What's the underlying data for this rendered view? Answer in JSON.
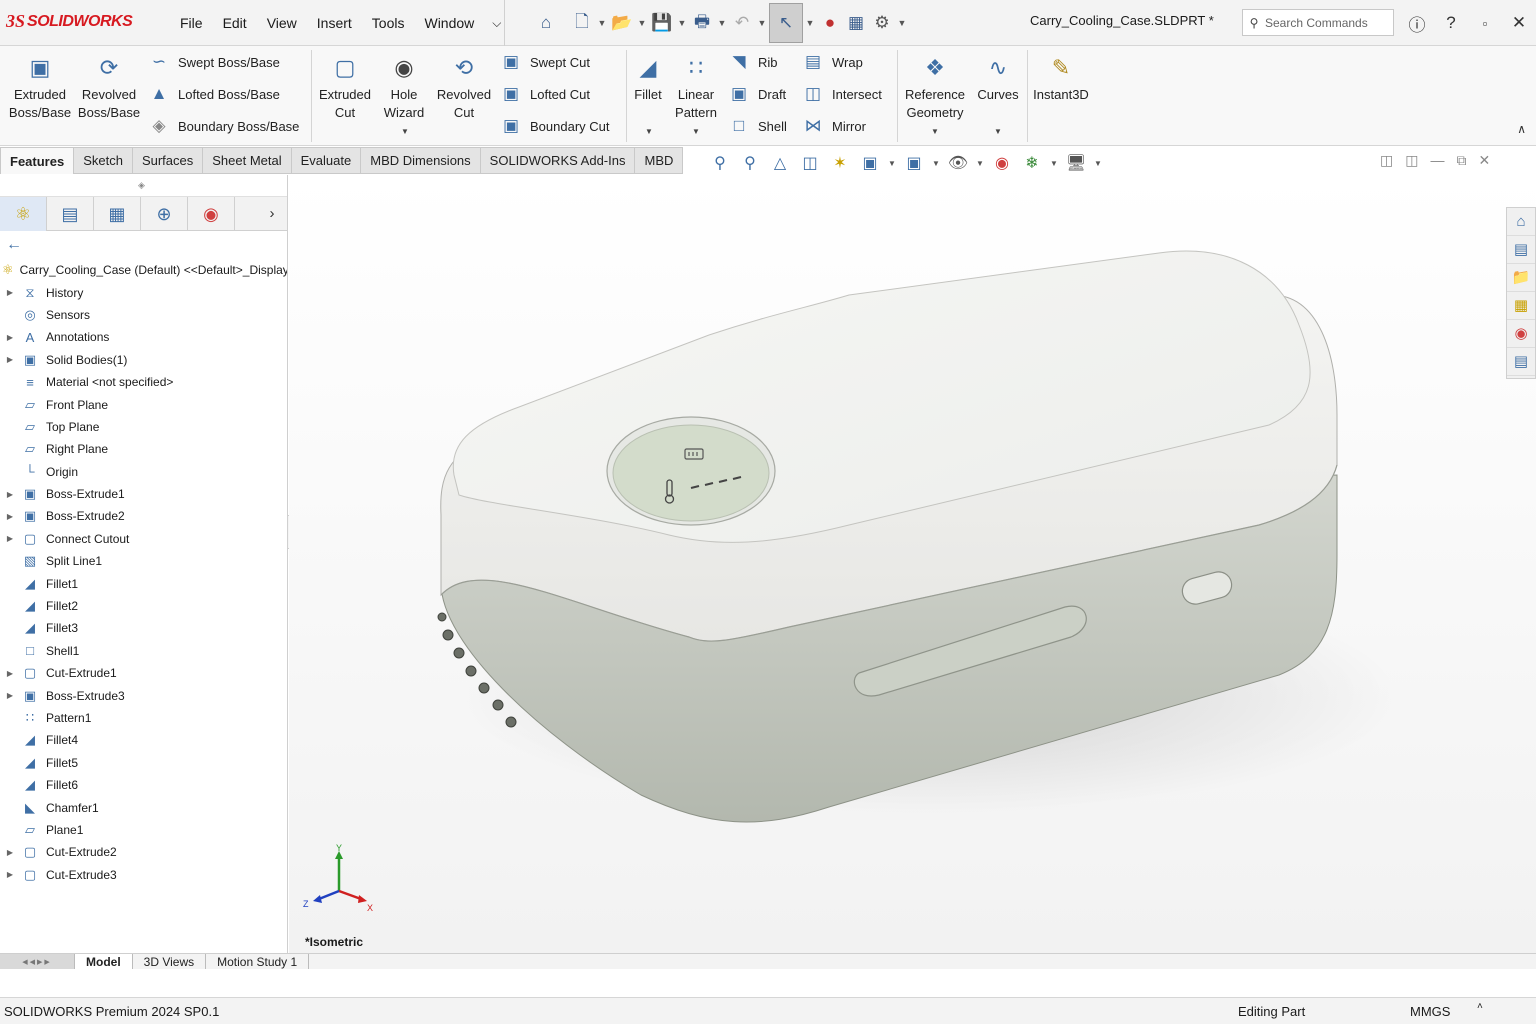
{
  "app": {
    "brand_ds": "3S",
    "brand_name": "SOLIDWORKS",
    "document_title": "Carry_Cooling_Case.SLDPRT *"
  },
  "menu": [
    "File",
    "Edit",
    "View",
    "Insert",
    "Tools",
    "Window"
  ],
  "search": {
    "placeholder": "Search Commands"
  },
  "ribbon": {
    "extruded_boss": "Extruded\nBoss/Base",
    "revolved_boss": "Revolved\nBoss/Base",
    "swept_boss": "Swept Boss/Base",
    "lofted_boss": "Lofted Boss/Base",
    "boundary_boss": "Boundary Boss/Base",
    "extruded_cut": "Extruded\nCut",
    "hole_wizard": "Hole\nWizard",
    "revolved_cut": "Revolved\nCut",
    "swept_cut": "Swept Cut",
    "lofted_cut": "Lofted Cut",
    "boundary_cut": "Boundary Cut",
    "fillet": "Fillet",
    "linear_pattern": "Linear\nPattern",
    "rib": "Rib",
    "draft": "Draft",
    "shell": "Shell",
    "wrap": "Wrap",
    "intersect": "Intersect",
    "mirror": "Mirror",
    "reference_geometry": "Reference\nGeometry",
    "curves": "Curves",
    "instant3d": "Instant3D"
  },
  "cm_tabs": [
    "Features",
    "Sketch",
    "Surfaces",
    "Sheet Metal",
    "Evaluate",
    "MBD Dimensions",
    "SOLIDWORKS Add-Ins",
    "MBD"
  ],
  "tree": {
    "root": "Carry_Cooling_Case (Default) <<Default>_Display St",
    "items": [
      {
        "label": "History",
        "exp": true,
        "icon": "history-icon"
      },
      {
        "label": "Sensors",
        "exp": false,
        "icon": "sensor-icon"
      },
      {
        "label": "Annotations",
        "exp": true,
        "icon": "annotation-icon"
      },
      {
        "label": "Solid Bodies(1)",
        "exp": true,
        "icon": "solid-bodies-icon"
      },
      {
        "label": "Material <not specified>",
        "exp": false,
        "icon": "material-icon"
      },
      {
        "label": "Front Plane",
        "exp": false,
        "icon": "plane-icon"
      },
      {
        "label": "Top Plane",
        "exp": false,
        "icon": "plane-icon"
      },
      {
        "label": "Right Plane",
        "exp": false,
        "icon": "plane-icon"
      },
      {
        "label": "Origin",
        "exp": false,
        "icon": "origin-icon"
      },
      {
        "label": "Boss-Extrude1",
        "exp": true,
        "icon": "extrude-icon"
      },
      {
        "label": "Boss-Extrude2",
        "exp": true,
        "icon": "extrude-icon"
      },
      {
        "label": "Connect Cutout",
        "exp": true,
        "icon": "cut-icon"
      },
      {
        "label": "Split Line1",
        "exp": false,
        "icon": "split-line-icon"
      },
      {
        "label": "Fillet1",
        "exp": false,
        "icon": "fillet-icon"
      },
      {
        "label": "Fillet2",
        "exp": false,
        "icon": "fillet-icon"
      },
      {
        "label": "Fillet3",
        "exp": false,
        "icon": "fillet-icon"
      },
      {
        "label": "Shell1",
        "exp": false,
        "icon": "shell-icon"
      },
      {
        "label": "Cut-Extrude1",
        "exp": true,
        "icon": "cut-icon"
      },
      {
        "label": "Boss-Extrude3",
        "exp": true,
        "icon": "extrude-icon"
      },
      {
        "label": "Pattern1",
        "exp": false,
        "icon": "pattern-icon"
      },
      {
        "label": "Fillet4",
        "exp": false,
        "icon": "fillet-icon"
      },
      {
        "label": "Fillet5",
        "exp": false,
        "icon": "fillet-icon"
      },
      {
        "label": "Fillet6",
        "exp": false,
        "icon": "fillet-icon"
      },
      {
        "label": "Chamfer1",
        "exp": false,
        "icon": "chamfer-icon"
      },
      {
        "label": "Plane1",
        "exp": false,
        "icon": "plane-icon"
      },
      {
        "label": "Cut-Extrude2",
        "exp": true,
        "icon": "cut-icon"
      },
      {
        "label": "Cut-Extrude3",
        "exp": true,
        "icon": "cut-icon"
      }
    ]
  },
  "viewport": {
    "view_name": "*Isometric",
    "triad": {
      "x": "X",
      "y": "Y",
      "z": "Z"
    }
  },
  "bottom_tabs": [
    "Model",
    "3D Views",
    "Motion Study 1"
  ],
  "status": {
    "product": "SOLIDWORKS Premium 2024 SP0.1",
    "mode": "Editing Part",
    "units": "MMGS",
    "customize": "˄"
  },
  "colors": {
    "brand": "#d71920",
    "lid": "#f2f2f0",
    "base": "#c7cbc1",
    "display": "#d3dccb",
    "accent": "#3f6fa5"
  }
}
